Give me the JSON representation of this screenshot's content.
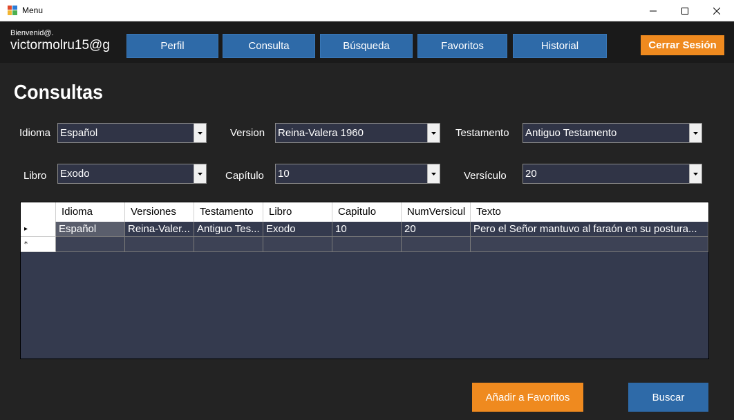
{
  "window": {
    "title": "Menu"
  },
  "header": {
    "welcome": "Bienvenid@.",
    "username": "victormolru15@g",
    "nav": {
      "perfil": "Perfil",
      "consulta": "Consulta",
      "busqueda": "Búsqueda",
      "favoritos": "Favoritos",
      "historial": "Historial"
    },
    "logout": "Cerrar Sesión"
  },
  "page": {
    "title": "Consultas"
  },
  "form": {
    "idioma": {
      "label": "Idioma",
      "value": "Español"
    },
    "version": {
      "label": "Version",
      "value": "Reina-Valera 1960"
    },
    "testamento": {
      "label": "Testamento",
      "value": "Antiguo Testamento"
    },
    "libro": {
      "label": "Libro",
      "value": "Exodo"
    },
    "capitulo": {
      "label": "Capítulo",
      "value": "10"
    },
    "versiculo": {
      "label": "Versículo",
      "value": "20"
    }
  },
  "grid": {
    "columns": [
      "Idioma",
      "Versiones",
      "Testamento",
      "Libro",
      "Capitulo",
      "NumVersicul",
      "Texto"
    ],
    "rows": [
      [
        "Español",
        "Reina-Valer...",
        "Antiguo Tes...",
        "Exodo",
        "10",
        "20",
        "Pero el Señor mantuvo al faraón en su postura..."
      ]
    ],
    "current_row_marker": "▸",
    "new_row_marker": "*"
  },
  "actions": {
    "add_favorite": "Añadir a Favoritos",
    "search": "Buscar"
  },
  "colors": {
    "accent_blue": "#2e6aa8",
    "accent_orange": "#ef8a1f",
    "background": "#232323",
    "grid_bg": "#343a4e"
  }
}
